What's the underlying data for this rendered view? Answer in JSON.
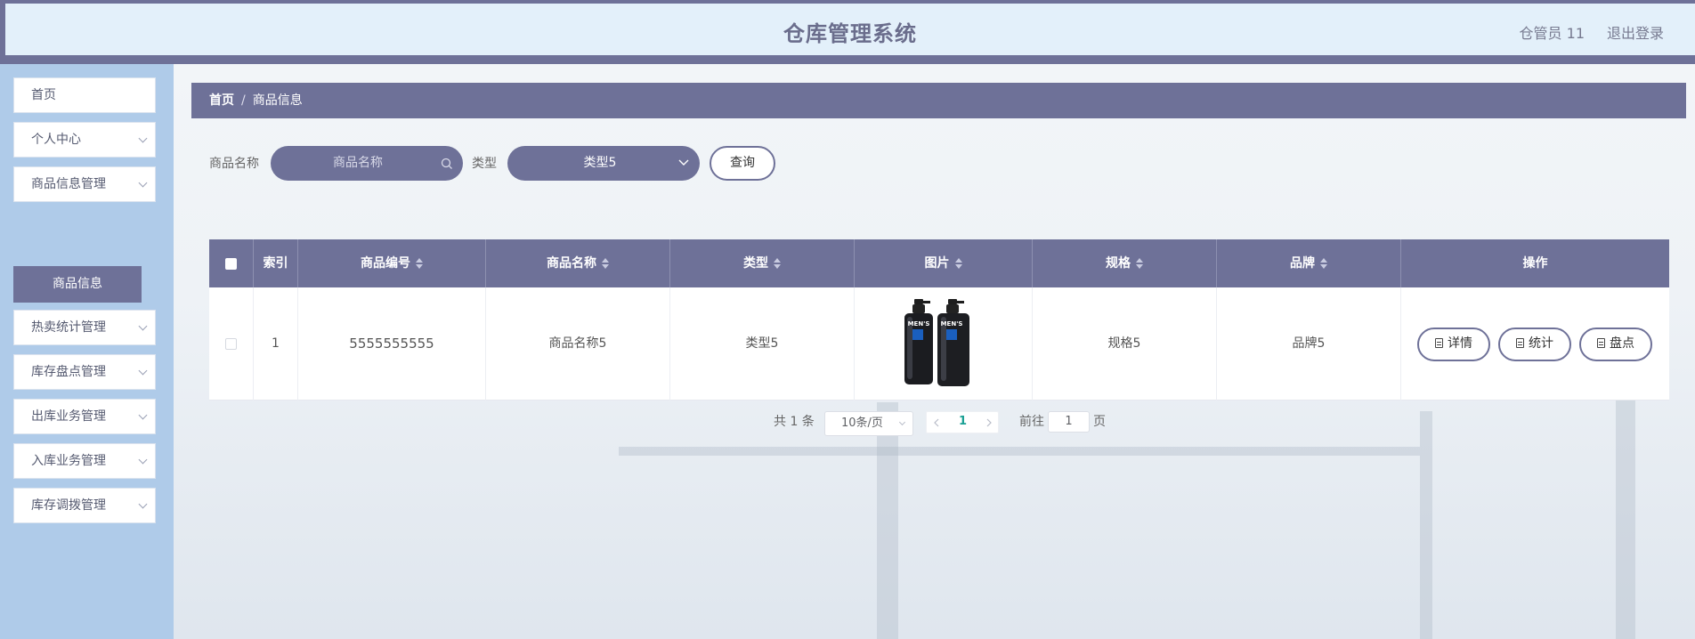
{
  "header": {
    "title": "仓库管理系统",
    "user": "仓管员 11",
    "logout": "退出登录"
  },
  "sidebar": {
    "items": [
      {
        "label": "首页"
      },
      {
        "label": "个人中心"
      },
      {
        "label": "商品信息管理"
      },
      {
        "label": "热卖统计管理"
      },
      {
        "label": "库存盘点管理"
      },
      {
        "label": "出库业务管理"
      },
      {
        "label": "入库业务管理"
      },
      {
        "label": "库存调拨管理"
      }
    ],
    "active_sub": "商品信息"
  },
  "breadcrumb": {
    "home": "首页",
    "sep": "/",
    "current": "商品信息"
  },
  "search": {
    "name_label": "商品名称",
    "name_placeholder": "商品名称",
    "type_label": "类型",
    "type_value": "类型5",
    "query_button": "查询"
  },
  "table": {
    "headers": {
      "index": "索引",
      "code": "商品编号",
      "name": "商品名称",
      "type": "类型",
      "image": "图片",
      "spec": "规格",
      "brand": "品牌",
      "actions": "操作"
    },
    "rows": [
      {
        "index": "1",
        "code": "5555555555",
        "name": "商品名称5",
        "type": "类型5",
        "image_label": "MEN'S",
        "spec": "规格5",
        "brand": "品牌5"
      }
    ],
    "row_actions": {
      "detail": "详情",
      "stats": "统计",
      "inventory": "盘点"
    }
  },
  "pagination": {
    "total_text": "共 1 条",
    "page_size": "10条/页",
    "current_page": "1",
    "goto_label": "前往",
    "goto_value": "1",
    "page_unit": "页"
  },
  "colors": {
    "primary": "#6e7198",
    "sidebar_bg": "#afcbe9",
    "header_bg": "#e3f0fa",
    "page_active": "#1aa094"
  },
  "icons": {
    "search": "search-icon",
    "dropdown": "chevron-down-icon",
    "document": "document-icon",
    "prev": "chevron-left-icon",
    "next": "chevron-right-icon"
  }
}
